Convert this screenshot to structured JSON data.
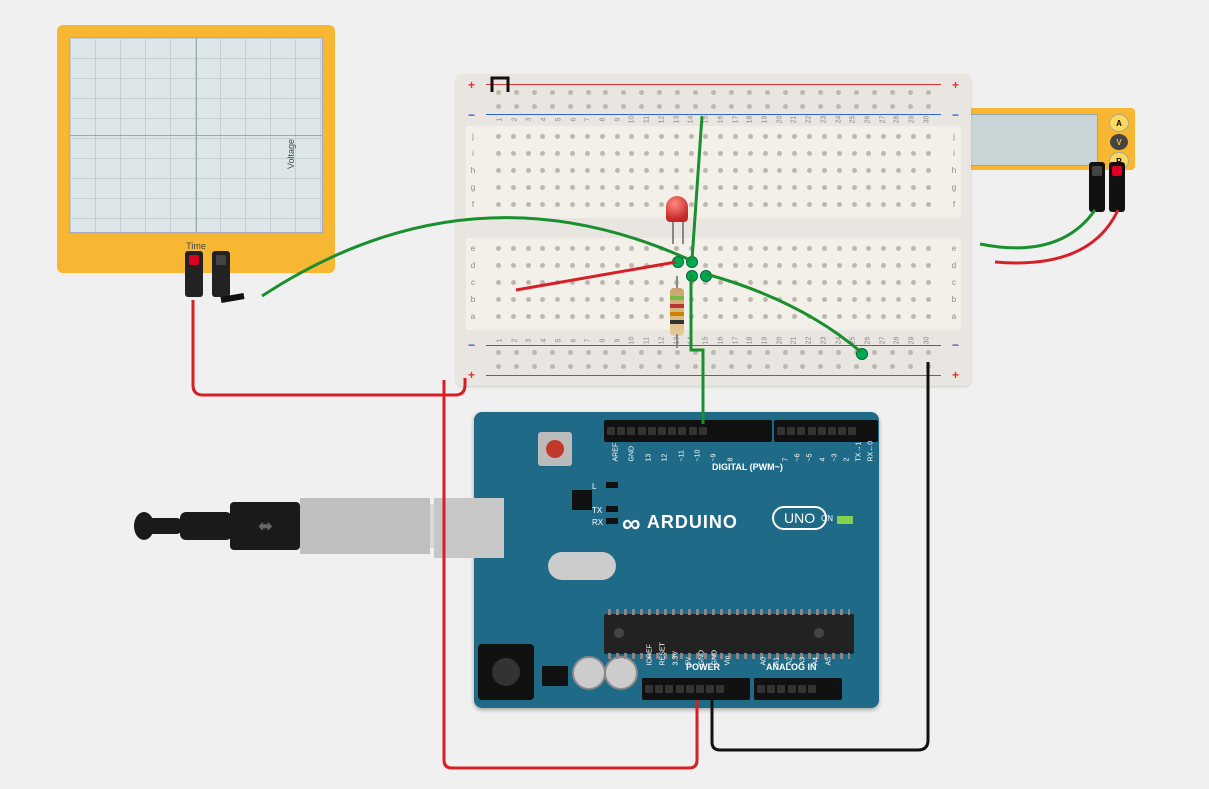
{
  "oscilloscope": {
    "x_axis": "Time",
    "y_axis": "Voltage"
  },
  "multimeter": {
    "mode_amp": "A",
    "mode_volt": "V",
    "mode_res": "R"
  },
  "breadboard": {
    "rail_plus": "+",
    "rail_minus": "−",
    "columns": [
      "1",
      "2",
      "3",
      "4",
      "5",
      "6",
      "7",
      "8",
      "9",
      "10",
      "11",
      "12",
      "13",
      "14",
      "15",
      "16",
      "17",
      "18",
      "19",
      "20",
      "21",
      "22",
      "23",
      "24",
      "25",
      "26",
      "27",
      "28",
      "29",
      "30"
    ],
    "rows_upper": [
      "j",
      "i",
      "h",
      "g",
      "f"
    ],
    "rows_lower": [
      "e",
      "d",
      "c",
      "b",
      "a"
    ]
  },
  "arduino": {
    "brand": "ARDUINO",
    "model": "UNO",
    "section_digital": "DIGITAL (PWM~)",
    "section_power": "POWER",
    "section_analog": "ANALOG IN",
    "on_label": "ON",
    "led_L": "L",
    "led_TX": "TX",
    "led_RX": "RX",
    "pins_top": [
      "AREF",
      "GND",
      "13",
      "12",
      "~11",
      "~10",
      "~9",
      "8",
      "7",
      "~6",
      "~5",
      "4",
      "~3",
      "2",
      "TX→1",
      "RX←0"
    ],
    "pins_power": [
      "IOREF",
      "RESET",
      "3.3V",
      "5V",
      "GND",
      "GND",
      "Vin"
    ],
    "pins_analog": [
      "A0",
      "A1",
      "A2",
      "A3",
      "A4",
      "A5"
    ]
  },
  "components": {
    "led_color": "#c62828",
    "resistor_desc": "axial resistor (4-band)"
  },
  "wires": [
    {
      "color": "red",
      "from": "oscilloscope ch+",
      "to": "breadboard bottom + rail"
    },
    {
      "color": "black",
      "from": "oscilloscope ch−",
      "to": "(short stub)"
    },
    {
      "color": "green",
      "from": "oscilloscope ch−",
      "to": "breadboard upper area / LED cathode node"
    },
    {
      "color": "red",
      "from": "Arduino 5V",
      "to": "breadboard bottom + rail"
    },
    {
      "color": "black",
      "from": "Arduino GND",
      "to": "breadboard bottom − rail"
    },
    {
      "color": "black",
      "from": "breadboard top − rail",
      "to": "breadboard top − rail (jumper)"
    },
    {
      "color": "green",
      "from": "Arduino ~9",
      "to": "LED/resistor node"
    },
    {
      "color": "green",
      "from": "LED anode row",
      "to": "breadboard top rail"
    },
    {
      "color": "red",
      "from": "LED node",
      "to": "left along row"
    },
    {
      "color": "green",
      "from": "node",
      "to": "multimeter − probe tie"
    },
    {
      "color": "green",
      "from": "multimeter −",
      "to": "breadboard right"
    },
    {
      "color": "red",
      "from": "multimeter +",
      "to": "breadboard right"
    }
  ]
}
